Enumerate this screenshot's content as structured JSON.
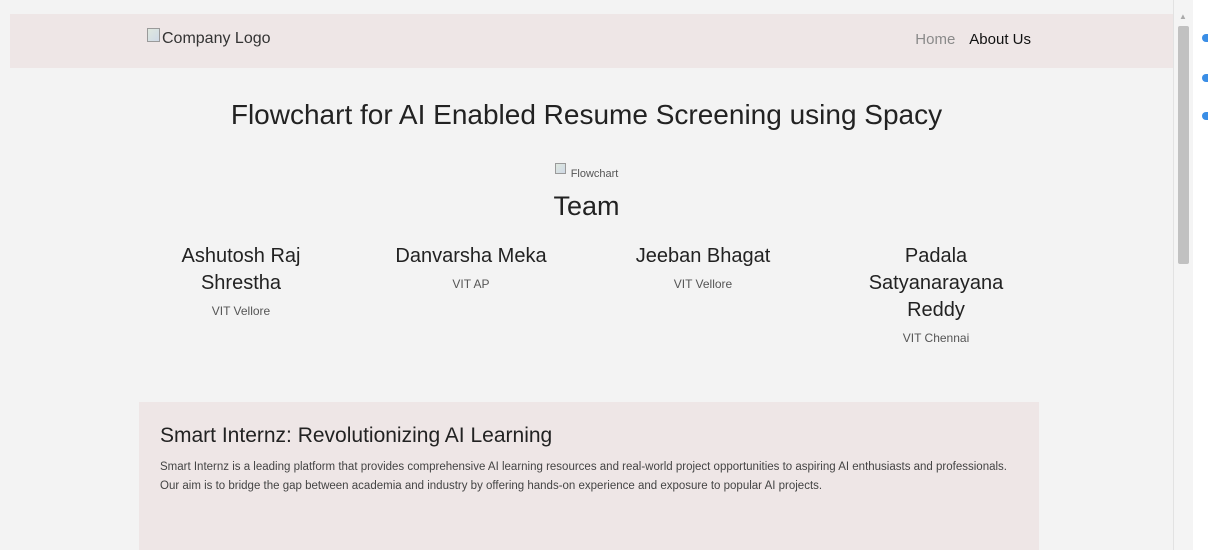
{
  "header": {
    "logo_alt": "Company Logo",
    "nav": {
      "home": "Home",
      "about": "About Us"
    }
  },
  "main": {
    "title": "Flowchart for AI Enabled Resume Screening using Spacy",
    "flowchart_alt": "Flowchart",
    "team_heading": "Team",
    "members": [
      {
        "name": "Ashutosh Raj Shrestha",
        "school": "VIT Vellore"
      },
      {
        "name": "Danvarsha Meka",
        "school": "VIT AP"
      },
      {
        "name": "Jeeban Bhagat",
        "school": "VIT Vellore"
      },
      {
        "name": "Padala Satyanarayana Reddy",
        "school": "VIT Chennai"
      }
    ]
  },
  "info": {
    "title": "Smart Internz: Revolutionizing AI Learning",
    "text": "Smart Internz is a leading platform that provides comprehensive AI learning resources and real-world project opportunities to aspiring AI enthusiasts and professionals. Our aim is to bridge the gap between academia and industry by offering hands-on experience and exposure to popular AI projects."
  },
  "colors": {
    "header_bg": "#eee6e6",
    "page_bg": "#f3f3f3",
    "nav_muted": "#8a8a8a",
    "side_accent": "#3a8ee6"
  }
}
